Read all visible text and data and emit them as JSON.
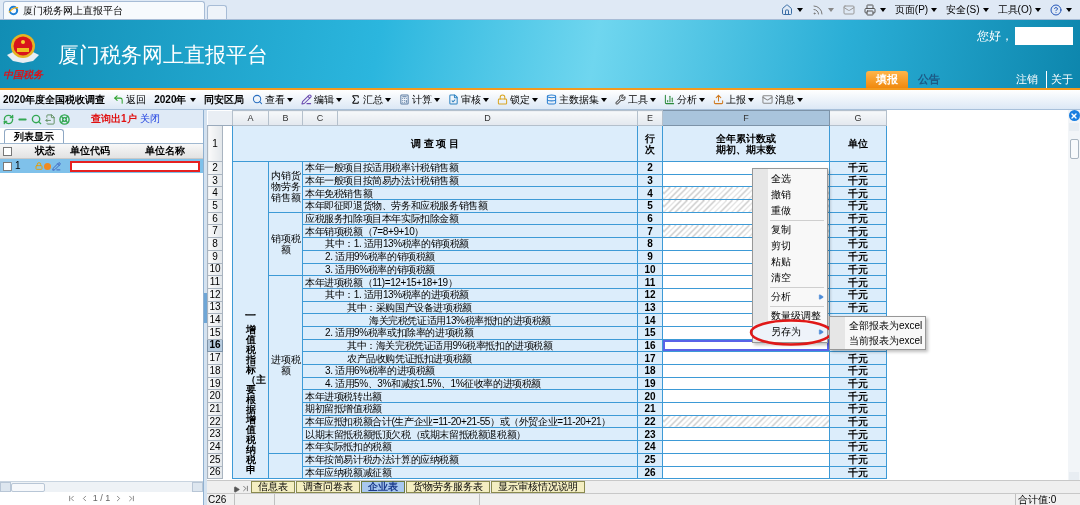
{
  "browser": {
    "tab_title": "厦门税务网上直报平台",
    "commands": [
      {
        "kind": "home"
      },
      {
        "kind": "feeds"
      },
      {
        "kind": "mail"
      },
      {
        "kind": "print"
      },
      {
        "kind": "menu",
        "label": "页面(P)"
      },
      {
        "kind": "menu",
        "label": "安全(S)"
      },
      {
        "kind": "menu",
        "label": "工具(O)"
      },
      {
        "kind": "help"
      }
    ]
  },
  "header": {
    "logo_text": "中国税务",
    "title": "厦门税务网上直报平台",
    "greeting": "您好，",
    "nav_tabs": [
      {
        "label": "填报",
        "selected": true
      },
      {
        "label": "公告",
        "selected": false
      }
    ],
    "links": [
      "注销",
      "关于"
    ]
  },
  "toolbar": [
    {
      "kind": "title",
      "label": "2020年度全国税收调查"
    },
    {
      "kind": "button",
      "label": "返回"
    },
    {
      "kind": "select",
      "label": "2020年"
    },
    {
      "kind": "title",
      "label": "同安区局"
    },
    {
      "kind": "menu",
      "label": "查看"
    },
    {
      "kind": "menu",
      "label": "编辑"
    },
    {
      "kind": "menu",
      "label": "汇总"
    },
    {
      "kind": "menu",
      "label": "计算"
    },
    {
      "kind": "menu",
      "label": "审核"
    },
    {
      "kind": "menu",
      "label": "锁定"
    },
    {
      "kind": "menu",
      "label": "主数据集"
    },
    {
      "kind": "menu",
      "label": "工具"
    },
    {
      "kind": "menu",
      "label": "分析"
    },
    {
      "kind": "menu",
      "label": "上报"
    },
    {
      "kind": "menu",
      "label": "消息"
    }
  ],
  "left_panel": {
    "status": "查询出1户",
    "close_link": "关闭",
    "tabs": [
      {
        "label": "列表显示",
        "selected": true
      }
    ],
    "select_all_checked": false,
    "columns": [
      "状态",
      "单位代码",
      "单位名称"
    ],
    "rows": [
      {
        "number": "1",
        "selected": true,
        "checked": false
      }
    ],
    "pager": "1 / 1"
  },
  "sheet": {
    "columns": [
      {
        "label": "A",
        "selected": false
      },
      {
        "label": "B",
        "selected": false
      },
      {
        "label": "C",
        "selected": false
      },
      {
        "label": "D",
        "selected": false
      },
      {
        "label": "E",
        "selected": false
      },
      {
        "label": "F",
        "selected": true
      },
      {
        "label": "G",
        "selected": false
      }
    ],
    "header": {
      "row": "1",
      "item": "调 查 项 目",
      "line": "行次",
      "value": [
        "全年累计数或",
        "期初、期末数"
      ],
      "unit": "单位"
    },
    "sections": [
      {
        "number": "一",
        "title": "增值税指标（主要根据增值税纳税申",
        "groups": [
          {
            "label": "内销货物劳务销售额",
            "rows": [
              {
                "row": "2",
                "item": "本年一般项目按适用税率计税销售额",
                "line": "2",
                "unit": "千元",
                "hatched": false,
                "selected": false
              },
              {
                "row": "3",
                "item": "本年一般项目按简易办法计税销售额",
                "line": "3",
                "unit": "千元",
                "hatched": false,
                "selected": false
              },
              {
                "row": "4",
                "item": "本年免税销售额",
                "line": "4",
                "unit": "千元",
                "hatched": true,
                "selected": false
              },
              {
                "row": "5",
                "item": "本年即征即退货物、劳务和应税服务销售额",
                "line": "5",
                "unit": "千元",
                "hatched": true,
                "selected": false
              }
            ]
          },
          {
            "label": "销项税额",
            "rows": [
              {
                "row": "6",
                "item": "应税服务扣除项目本年实际扣除金额",
                "line": "6",
                "unit": "千元",
                "hatched": false,
                "selected": false
              },
              {
                "row": "7",
                "item": "本年销项税额（7=8+9+10）",
                "line": "7",
                "unit": "千元",
                "hatched": true,
                "selected": false,
                "children": [
                  {
                    "row": "8",
                    "item": "其中：1. 适用13%税率的销项税额",
                    "line": "8",
                    "unit": "千元",
                    "hatched": false,
                    "selected": false
                  },
                  {
                    "row": "9",
                    "item": "2. 适用9%税率的销项税额",
                    "line": "9",
                    "unit": "千元",
                    "hatched": false,
                    "selected": false
                  },
                  {
                    "row": "10",
                    "item": "3. 适用6%税率的销项税额",
                    "line": "10",
                    "unit": "千元",
                    "hatched": false,
                    "selected": false
                  }
                ]
              }
            ]
          },
          {
            "label": "进项税额",
            "rows": [
              {
                "row": "11",
                "item": "本年进项税额（11)=12+15+18+19）",
                "line": "11",
                "unit": "千元",
                "hatched": false,
                "selected": false,
                "children": [
                  {
                    "row": "12",
                    "item": "其中：1. 适用13%税率的进项税额",
                    "line": "12",
                    "unit": "千元",
                    "hatched": false,
                    "selected": false,
                    "children": [
                      {
                        "row": "13",
                        "item": "其中：采购国产设备进项税额",
                        "line": "13",
                        "unit": "千元",
                        "hatched": false,
                        "selected": false,
                        "children": [
                          {
                            "row": "14",
                            "item": "海关完税凭证适用13%税率抵扣的进项税额",
                            "line": "14",
                            "hatched": false,
                            "selected": false
                          }
                        ]
                      }
                    ]
                  },
                  {
                    "row": "15",
                    "item": "2. 适用9%税率或扣除率的进项税额",
                    "line": "15",
                    "hatched": false,
                    "selected": false,
                    "children": [
                      {
                        "row": "16",
                        "item": "其中：海关完税凭证适用9%税率抵扣的进项税额",
                        "line": "16",
                        "hatched": false,
                        "selected": true
                      },
                      {
                        "row": "17",
                        "item": "农产品收购凭证抵扣进项税额",
                        "line": "17",
                        "unit": "千元",
                        "hatched": false,
                        "selected": false
                      }
                    ]
                  },
                  {
                    "row": "18",
                    "item": "3. 适用6%税率的进项税额",
                    "line": "18",
                    "unit": "千元",
                    "hatched": false,
                    "selected": false
                  },
                  {
                    "row": "19",
                    "item": "4. 适用5%、3%和减按1.5%、1%征收率的进项税额",
                    "line": "19",
                    "unit": "千元",
                    "hatched": false,
                    "selected": false
                  }
                ]
              },
              {
                "row": "20",
                "item": "本年进项税转出额",
                "line": "20",
                "unit": "千元",
                "hatched": false,
                "selected": false
              },
              {
                "row": "21",
                "item": "期初留抵增值税额",
                "line": "21",
                "unit": "千元",
                "hatched": false,
                "selected": false
              },
              {
                "row": "22",
                "item": "本年应抵扣税额合计(生产企业=11-20+21-55）或（外贸企业=11-20+21）",
                "line": "22",
                "unit": "千元",
                "hatched": true,
                "selected": false
              },
              {
                "row": "23",
                "item": "以期末留抵税额抵顶欠税（或期末留抵税额退税额）",
                "line": "23",
                "unit": "千元",
                "hatched": false,
                "selected": false
              },
              {
                "row": "24",
                "item": "本年实际抵扣的税额",
                "line": "24",
                "unit": "千元",
                "hatched": false,
                "selected": false
              }
            ]
          },
          {
            "rows": [
              {
                "row": "25",
                "item": "本年按简易计税办法计算的应纳税额",
                "line": "25",
                "unit": "千元",
                "hatched": false,
                "selected": false
              },
              {
                "row": "26",
                "item": "本年应纳税额减征额",
                "line": "26",
                "unit": "千元",
                "hatched": false,
                "selected": false
              }
            ]
          }
        ]
      }
    ],
    "context_menu": [
      {
        "kind": "item",
        "label": "全选"
      },
      {
        "kind": "item",
        "label": "撤销"
      },
      {
        "kind": "item",
        "label": "重做"
      },
      {
        "kind": "separator"
      },
      {
        "kind": "item",
        "label": "复制"
      },
      {
        "kind": "item",
        "label": "剪切"
      },
      {
        "kind": "item",
        "label": "粘贴"
      },
      {
        "kind": "item",
        "label": "清空"
      },
      {
        "kind": "separator"
      },
      {
        "kind": "submenu",
        "label": "分析",
        "expanded": false
      },
      {
        "kind": "separator"
      },
      {
        "kind": "item",
        "label": "数量级调整"
      },
      {
        "kind": "submenu",
        "label": "另存为",
        "expanded": true
      }
    ],
    "submenu": [
      "全部报表为excel",
      "当前报表为excel"
    ],
    "sheet_tabs": [
      {
        "label": "信息表",
        "selected": false
      },
      {
        "label": "调查问卷表",
        "selected": false
      },
      {
        "label": "企业表",
        "selected": true
      },
      {
        "label": "货物劳务服务表",
        "selected": false
      },
      {
        "label": "显示审核情况说明",
        "selected": false
      }
    ],
    "status_bar": {
      "cell": "C26",
      "sum": "合计值:0"
    }
  }
}
